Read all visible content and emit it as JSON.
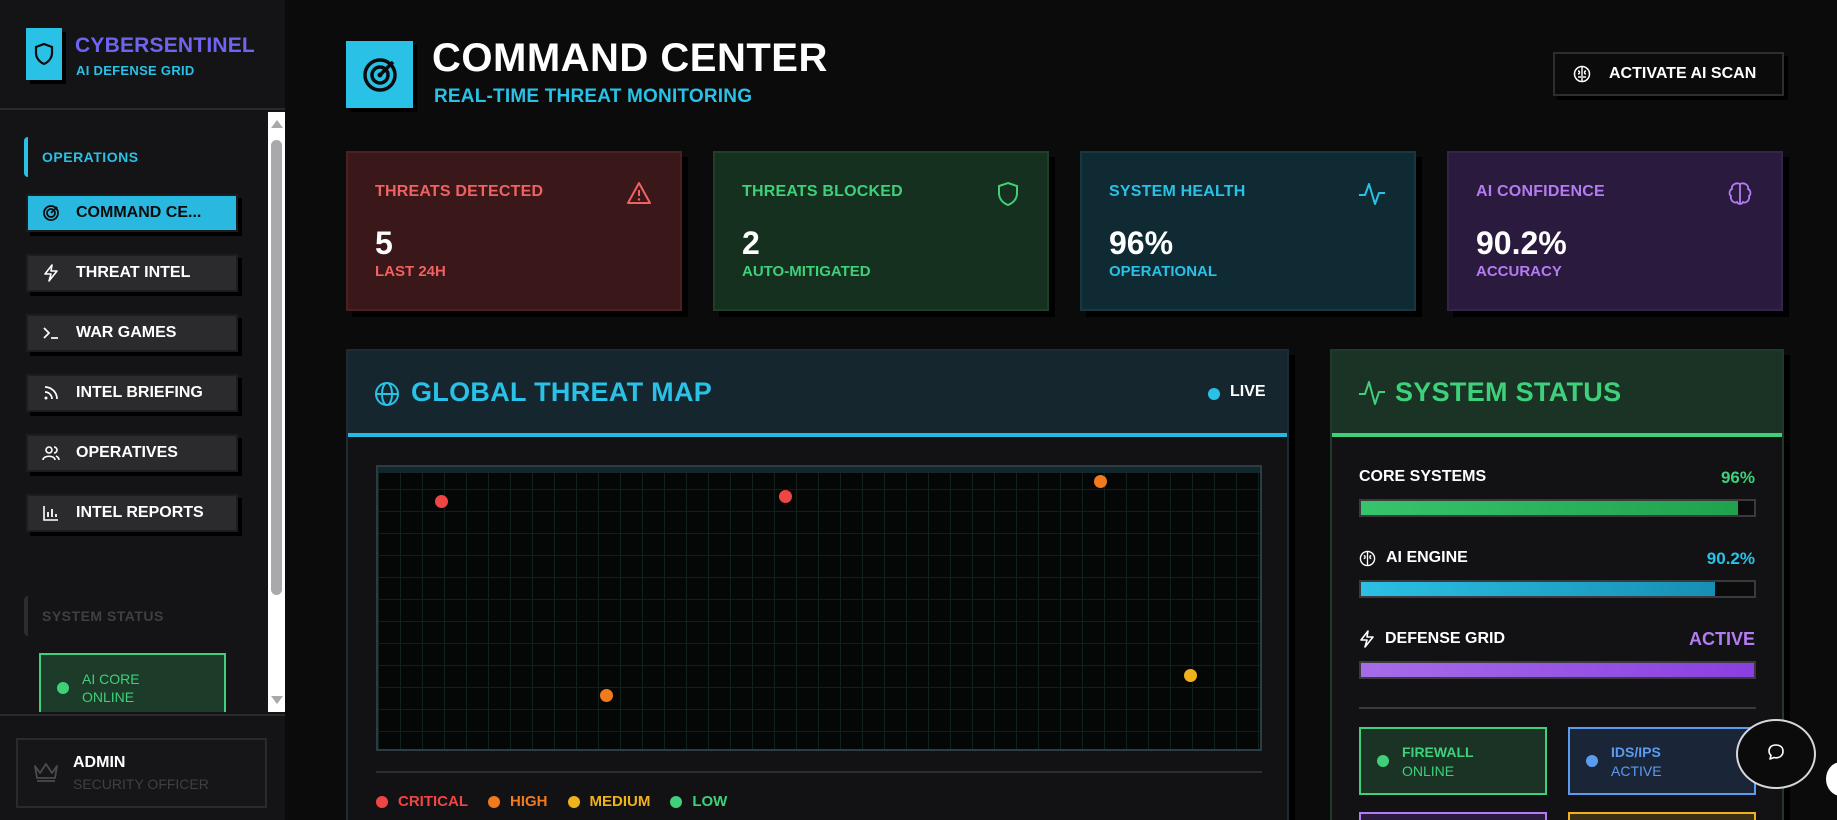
{
  "brand": {
    "title": "CYBERSENTINEL",
    "subtitle": "AI DEFENSE GRID",
    "logo_icon": "shield-icon"
  },
  "sidebar": {
    "section_operations": "OPERATIONS",
    "items": [
      {
        "label": "COMMAND CE...",
        "icon": "target-icon",
        "active": true
      },
      {
        "label": "THREAT INTEL",
        "icon": "lightning-icon",
        "active": false
      },
      {
        "label": "WAR GAMES",
        "icon": "terminal-icon",
        "active": false
      },
      {
        "label": "INTEL BRIEFING",
        "icon": "rss-icon",
        "active": false
      },
      {
        "label": "OPERATIVES",
        "icon": "users-icon",
        "active": false
      },
      {
        "label": "INTEL REPORTS",
        "icon": "bar-chart-icon",
        "active": false
      }
    ],
    "section_status": "SYSTEM STATUS",
    "status_card": {
      "line1": "AI CORE",
      "line2": "ONLINE"
    }
  },
  "user": {
    "name": "ADMIN",
    "role": "SECURITY OFFICER",
    "icon": "crown-icon"
  },
  "header": {
    "title": "COMMAND CENTER",
    "subtitle": "REAL-TIME THREAT MONITORING",
    "scan_button": "ACTIVATE AI SCAN"
  },
  "stats": [
    {
      "label": "THREATS DETECTED",
      "value": "5",
      "sub": "LAST 24H",
      "icon": "alert-triangle-icon",
      "color": "#f06262",
      "bg": "#3a1719"
    },
    {
      "label": "THREATS BLOCKED",
      "value": "2",
      "sub": "AUTO-MITIGATED",
      "icon": "shield-icon",
      "color": "#3ed07a",
      "bg": "#15301f"
    },
    {
      "label": "SYSTEM HEALTH",
      "value": "96%",
      "sub": "OPERATIONAL",
      "icon": "pulse-icon",
      "color": "#29c2e6",
      "bg": "#102a33"
    },
    {
      "label": "AI CONFIDENCE",
      "value": "90.2%",
      "sub": "ACCURACY",
      "icon": "brain-icon",
      "color": "#b47cf2",
      "bg": "#2a1a3d"
    }
  ],
  "threat_map": {
    "title": "GLOBAL THREAT MAP",
    "live": "LIVE",
    "threats": [
      {
        "severity": "critical"
      },
      {
        "severity": "critical"
      },
      {
        "severity": "high"
      },
      {
        "severity": "high"
      },
      {
        "severity": "medium"
      }
    ],
    "legend": [
      {
        "label": "CRITICAL",
        "color": "#f04545"
      },
      {
        "label": "HIGH",
        "color": "#f07a1c"
      },
      {
        "label": "MEDIUM",
        "color": "#efb21b"
      },
      {
        "label": "LOW",
        "color": "#3ed07a"
      }
    ]
  },
  "system_status": {
    "title": "SYSTEM STATUS",
    "metrics": [
      {
        "label": "CORE SYSTEMS",
        "value": "96%",
        "level": 0.96,
        "color": "#3ed07a",
        "icon": ""
      },
      {
        "label": "AI ENGINE",
        "value": "90.2%",
        "level": 0.902,
        "color": "#29c2e6",
        "icon": "brain-icon"
      },
      {
        "label": "DEFENSE GRID",
        "value": "ACTIVE",
        "level": 1.0,
        "color": "#b47cf2",
        "icon": "lightning-icon"
      }
    ],
    "services": [
      {
        "line1": "FIREWALL",
        "line2": "ONLINE",
        "color": "#3ed07a",
        "bg": "#1b3325"
      },
      {
        "line1": "IDS/IPS",
        "line2": "ACTIVE",
        "color": "#5b9cf0",
        "bg": "#1a2638"
      }
    ]
  }
}
